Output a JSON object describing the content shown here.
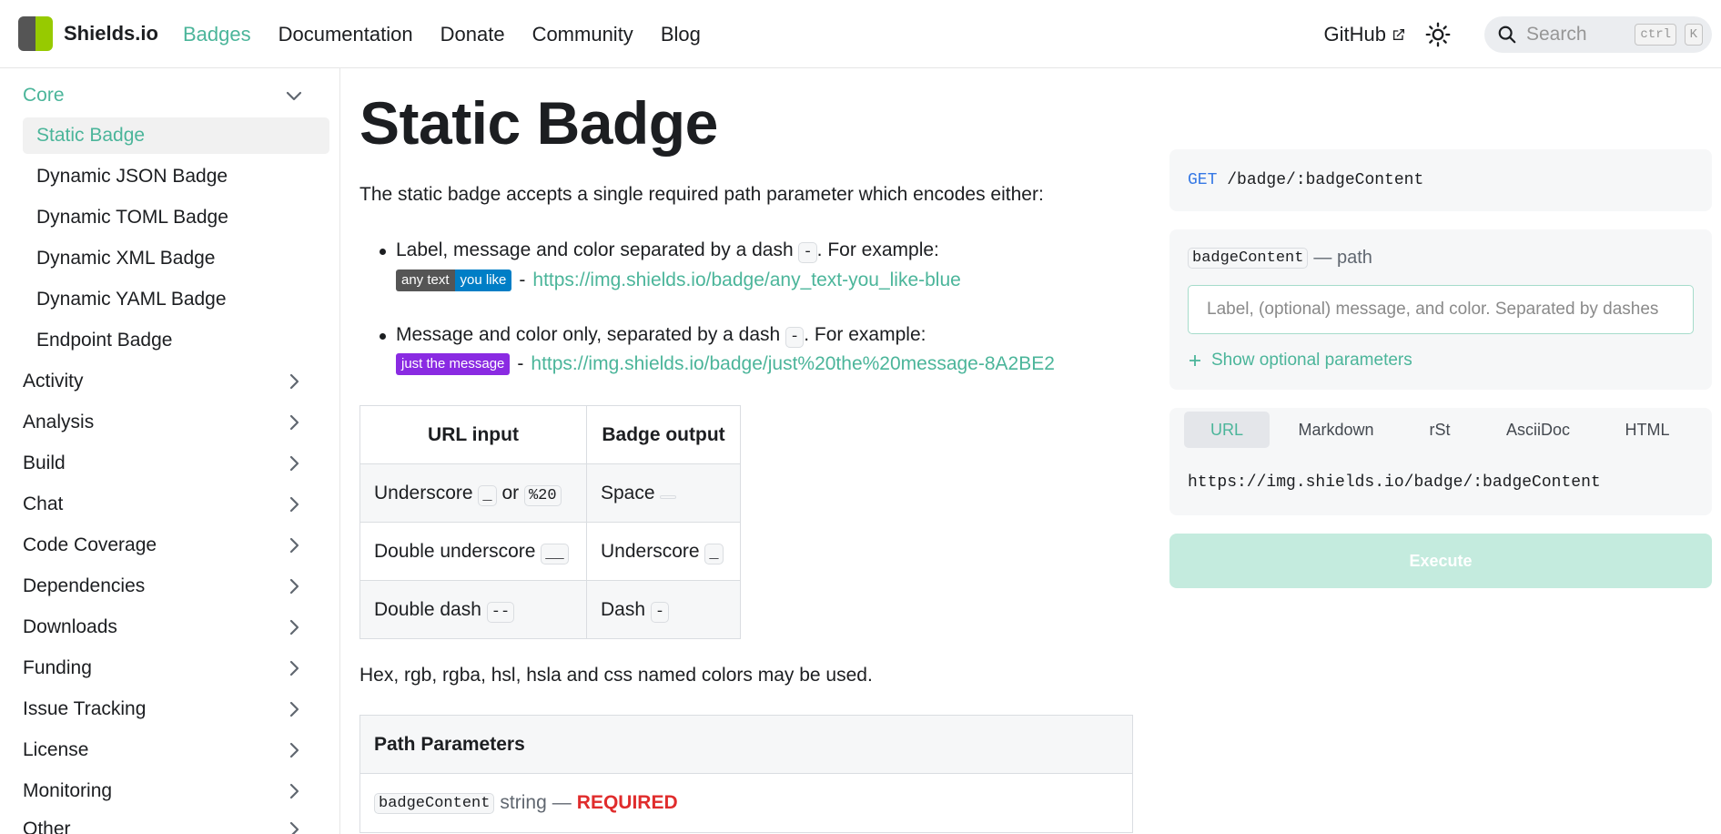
{
  "navbar": {
    "brand": "Shields.io",
    "links": [
      {
        "label": "Badges",
        "active": true
      },
      {
        "label": "Documentation",
        "active": false
      },
      {
        "label": "Donate",
        "active": false
      },
      {
        "label": "Community",
        "active": false
      },
      {
        "label": "Blog",
        "active": false
      }
    ],
    "github_label": "GitHub",
    "search_placeholder": "Search",
    "kbd_ctrl": "ctrl",
    "kbd_k": "K",
    "icons": [
      "external-link-icon",
      "sun-icon",
      "search-icon"
    ]
  },
  "sidebar": {
    "core_label": "Core",
    "core_items": [
      "Static Badge",
      "Dynamic JSON Badge",
      "Dynamic TOML Badge",
      "Dynamic XML Badge",
      "Dynamic YAML Badge",
      "Endpoint Badge"
    ],
    "active_item": "Static Badge",
    "categories": [
      "Activity",
      "Analysis",
      "Build",
      "Chat",
      "Code Coverage",
      "Dependencies",
      "Downloads",
      "Funding",
      "Issue Tracking",
      "License",
      "Monitoring",
      "Other"
    ]
  },
  "main": {
    "title": "Static Badge",
    "intro": "The static badge accepts a single required path parameter which encodes either:",
    "bullet1": {
      "text_before": "Label, message and color separated by a dash ",
      "dash": "-",
      "text_after": ". For example:",
      "badge_left": "any text",
      "badge_right": "you like",
      "badge_left_color": "#555555",
      "badge_right_color": "#007ec6",
      "sep": "-",
      "url": "https://img.shields.io/badge/any_text-you_like-blue"
    },
    "bullet2": {
      "text_before": "Message and color only, separated by a dash ",
      "dash": "-",
      "text_after": ". For example:",
      "badge": "just the message",
      "badge_color": "#8a2be2",
      "sep": "-",
      "url": "https://img.shields.io/badge/just%20the%20message-8A2BE2"
    },
    "table": {
      "headers": [
        "URL input",
        "Badge output"
      ],
      "rows": [
        {
          "in_text": "Underscore",
          "in_code": "_",
          "in_or": "or",
          "in_code2": "%20",
          "out_text": "Space",
          "out_code": " "
        },
        {
          "in_text": "Double underscore",
          "in_code": "__",
          "out_text": "Underscore",
          "out_code": "_"
        },
        {
          "in_text": "Double dash",
          "in_code": "--",
          "out_text": "Dash",
          "out_code": "-"
        }
      ]
    },
    "colors_note": "Hex, rgb, rgba, hsl, hsla and css named colors may be used.",
    "params": {
      "heading": "Path Parameters",
      "name": "badgeContent",
      "type": "string",
      "dash": "—",
      "required": "REQUIRED"
    }
  },
  "panel": {
    "method": "GET",
    "path": "/badge/:badgeContent",
    "field_name": "badgeContent",
    "field_kind": "— path",
    "input_placeholder": "Label, (optional) message, and color. Separated by dashes",
    "show_optional": "Show optional parameters",
    "tabs": [
      "URL",
      "Markdown",
      "rSt",
      "AsciiDoc",
      "HTML"
    ],
    "active_tab": "URL",
    "output_url": "https://img.shields.io/badge/:badgeContent",
    "execute_label": "Execute"
  },
  "colors": {
    "accent": "#4bb59a",
    "execute_disabled": "#c4ebde",
    "required": "#e02c2c"
  }
}
